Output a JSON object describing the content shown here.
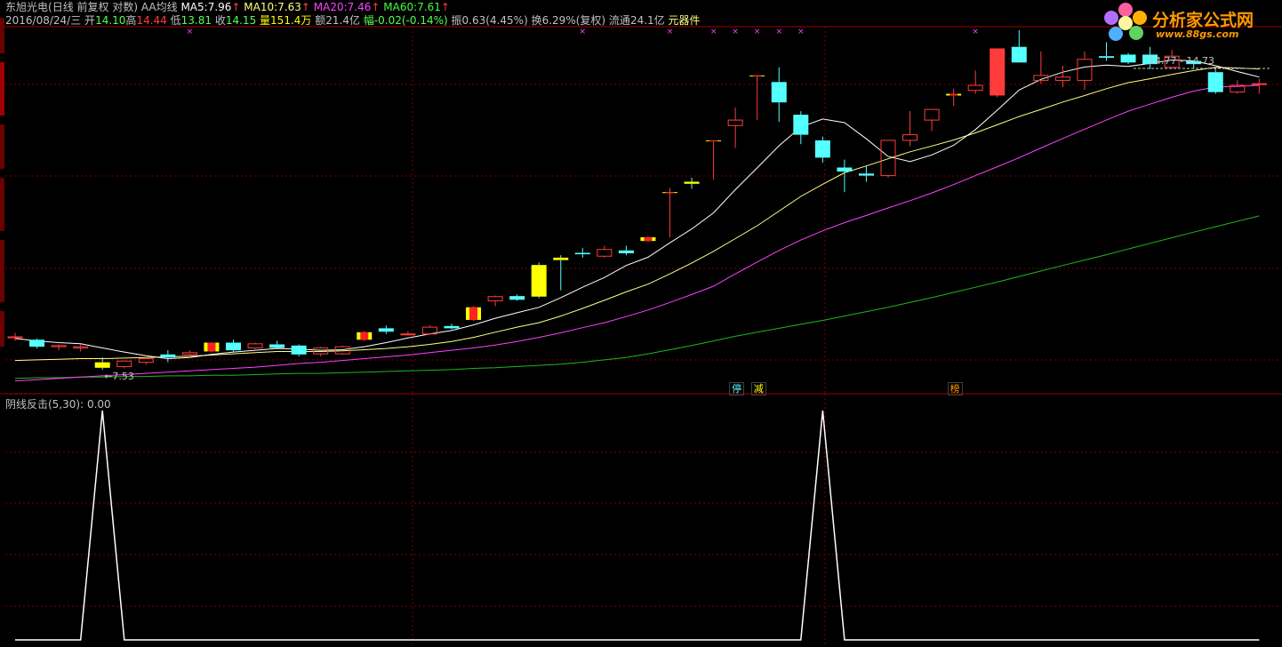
{
  "header": {
    "stock": "东旭光电",
    "mode": "(日线 前复权 对数)",
    "ma_title": "AA均线",
    "ma5_label": "MA5:",
    "ma5": "7.96",
    "ma10_label": "MA10:",
    "ma10": "7.63",
    "ma20_label": "MA20:",
    "ma20": "7.46",
    "ma60_label": "MA60:",
    "ma60": "7.61",
    "up_arrow": "↑",
    "date": "2016/08/24/三",
    "open_label": "开",
    "open": "14.10",
    "high_label": "高",
    "high": "14.44",
    "low_label": "低",
    "low": "13.81",
    "close_label": "收",
    "close": "14.15",
    "vol_label": "量",
    "vol": "151.4万",
    "amt_label": "额",
    "amt": "21.4亿",
    "chg_label": "幅",
    "chg": "-0.02(-0.14%)",
    "amp_label": "振",
    "amp": "0.63(4.45%)",
    "turn_label": "换",
    "turn": "6.29%(复权)",
    "float_label": "流通",
    "float": "24.1亿",
    "sector": "元器件"
  },
  "indicator": {
    "name": "阴线反击(5,30)",
    "value_text": ": 0.00"
  },
  "logo": {
    "text": "分析家公式网",
    "url": "www.88gs.com"
  },
  "colors": {
    "up": "#ff3c3c",
    "down": "#54ffff",
    "ma5": "#ffffff",
    "ma10": "#ffff80",
    "ma20": "#ff40ff",
    "ma60": "#1db81d",
    "signal": "#ffff00",
    "grid": "#800000"
  },
  "chart_data": {
    "type": "candlestick",
    "log_scale": true,
    "price_axis_range": [
      7.3,
      15.6
    ],
    "low_marker": "←7.53",
    "high_marker": "14.77 - 14.73",
    "tags": [
      {
        "text": "停",
        "index": 33
      },
      {
        "text": "减",
        "index": 34
      },
      {
        "text": "榜",
        "index": 43
      }
    ],
    "ohlc": [
      [
        8.05,
        8.12,
        7.98,
        8.05
      ],
      [
        8.0,
        8.02,
        7.85,
        7.88
      ],
      [
        7.88,
        7.92,
        7.82,
        7.9
      ],
      [
        7.86,
        7.92,
        7.8,
        7.88
      ],
      [
        7.62,
        7.7,
        7.5,
        7.53
      ],
      [
        7.55,
        7.65,
        7.52,
        7.64
      ],
      [
        7.62,
        7.7,
        7.58,
        7.68
      ],
      [
        7.75,
        7.82,
        7.62,
        7.7
      ],
      [
        7.75,
        7.82,
        7.7,
        7.78
      ],
      [
        7.8,
        7.96,
        7.78,
        7.95
      ],
      [
        7.95,
        8.0,
        7.8,
        7.82
      ],
      [
        7.86,
        7.95,
        7.84,
        7.93
      ],
      [
        7.92,
        7.98,
        7.85,
        7.86
      ],
      [
        7.9,
        7.92,
        7.72,
        7.75
      ],
      [
        7.76,
        7.88,
        7.72,
        7.86
      ],
      [
        7.76,
        7.9,
        7.74,
        7.88
      ],
      [
        8.0,
        8.15,
        7.98,
        8.13
      ],
      [
        8.2,
        8.25,
        8.1,
        8.14
      ],
      [
        8.1,
        8.15,
        8.07,
        8.1
      ],
      [
        8.1,
        8.25,
        8.08,
        8.22
      ],
      [
        8.24,
        8.28,
        8.18,
        8.2
      ],
      [
        8.35,
        8.6,
        8.33,
        8.58
      ],
      [
        8.7,
        8.8,
        8.6,
        8.78
      ],
      [
        8.79,
        8.82,
        8.7,
        8.72
      ],
      [
        9.4,
        9.45,
        8.75,
        8.78
      ],
      [
        9.55,
        9.6,
        8.9,
        9.5
      ],
      [
        9.65,
        9.75,
        9.55,
        9.62
      ],
      [
        9.58,
        9.8,
        9.55,
        9.72
      ],
      [
        9.7,
        9.8,
        9.6,
        9.64
      ],
      [
        9.9,
        10.0,
        9.88,
        9.98
      ],
      [
        11.0,
        11.1,
        9.98,
        11.0
      ],
      [
        11.25,
        11.35,
        11.08,
        11.2
      ],
      [
        12.3,
        12.3,
        11.3,
        12.3
      ],
      [
        12.7,
        13.2,
        12.1,
        12.85
      ],
      [
        14.15,
        14.15,
        12.85,
        14.15
      ],
      [
        13.95,
        14.4,
        12.8,
        13.35
      ],
      [
        13.0,
        13.1,
        12.2,
        12.45
      ],
      [
        12.3,
        12.4,
        11.72,
        11.85
      ],
      [
        11.6,
        11.8,
        11.0,
        11.5
      ],
      [
        11.45,
        11.65,
        11.25,
        11.4
      ],
      [
        11.4,
        12.3,
        11.35,
        12.3
      ],
      [
        12.3,
        13.1,
        12.15,
        12.45
      ],
      [
        12.85,
        13.15,
        12.55,
        13.15
      ],
      [
        13.55,
        13.75,
        13.25,
        13.6
      ],
      [
        13.7,
        14.3,
        13.6,
        13.85
      ],
      [
        13.55,
        15.0,
        13.5,
        15.0
      ],
      [
        15.05,
        15.6,
        14.9,
        14.55
      ],
      [
        14.0,
        14.9,
        13.9,
        14.15
      ],
      [
        14.0,
        14.45,
        13.8,
        14.1
      ],
      [
        14.0,
        14.9,
        13.72,
        14.65
      ],
      [
        14.75,
        15.2,
        14.6,
        14.7
      ],
      [
        14.8,
        14.85,
        14.5,
        14.55
      ],
      [
        14.8,
        15.05,
        14.35,
        14.5
      ],
      [
        14.4,
        14.95,
        14.35,
        14.75
      ],
      [
        14.6,
        14.6,
        14.35,
        14.5
      ],
      [
        14.25,
        14.35,
        13.6,
        13.65
      ],
      [
        13.65,
        14.0,
        13.6,
        13.85
      ],
      [
        13.88,
        14.05,
        13.6,
        13.9
      ]
    ],
    "signals": [
      0,
      0,
      0,
      0,
      1,
      0,
      0,
      0,
      0,
      1,
      0,
      0,
      0,
      0,
      0,
      0,
      1,
      0,
      0,
      0,
      0,
      1,
      0,
      0,
      1,
      1,
      0,
      0,
      0,
      1,
      1,
      1,
      1,
      0,
      1,
      0,
      0,
      0,
      0,
      0,
      0,
      0,
      0,
      1,
      0,
      0,
      0,
      0,
      0,
      0,
      0,
      0,
      0,
      0,
      0,
      0,
      0,
      0
    ],
    "ma5": [
      8.02,
      7.98,
      7.95,
      7.93,
      7.86,
      7.79,
      7.73,
      7.68,
      7.7,
      7.75,
      7.79,
      7.82,
      7.85,
      7.84,
      7.82,
      7.83,
      7.88,
      7.95,
      8.03,
      8.1,
      8.16,
      8.26,
      8.38,
      8.48,
      8.58,
      8.76,
      8.96,
      9.15,
      9.39,
      9.56,
      9.86,
      10.16,
      10.52,
      11.06,
      11.59,
      12.16,
      12.66,
      12.88,
      12.78,
      12.34,
      11.88,
      11.75,
      11.92,
      12.17,
      12.59,
      13.13,
      13.71,
      14.03,
      14.25,
      14.41,
      14.47,
      14.43,
      14.52,
      14.63,
      14.6,
      14.45,
      14.27,
      14.1
    ],
    "ma10": [
      7.65,
      7.66,
      7.67,
      7.68,
      7.68,
      7.69,
      7.7,
      7.71,
      7.72,
      7.74,
      7.76,
      7.78,
      7.8,
      7.8,
      7.8,
      7.81,
      7.83,
      7.85,
      7.88,
      7.92,
      7.97,
      8.04,
      8.13,
      8.22,
      8.3,
      8.42,
      8.56,
      8.71,
      8.87,
      9.02,
      9.22,
      9.44,
      9.68,
      9.95,
      10.23,
      10.56,
      10.9,
      11.19,
      11.47,
      11.64,
      11.82,
      12.0,
      12.15,
      12.31,
      12.5,
      12.72,
      12.95,
      13.15,
      13.36,
      13.55,
      13.75,
      13.93,
      14.05,
      14.18,
      14.3,
      14.4,
      14.38,
      14.35
    ],
    "ma20": [
      7.32,
      7.34,
      7.36,
      7.38,
      7.4,
      7.42,
      7.44,
      7.46,
      7.48,
      7.5,
      7.52,
      7.54,
      7.57,
      7.6,
      7.62,
      7.65,
      7.68,
      7.71,
      7.74,
      7.78,
      7.82,
      7.86,
      7.91,
      7.97,
      8.04,
      8.12,
      8.21,
      8.3,
      8.41,
      8.53,
      8.67,
      8.82,
      8.98,
      9.22,
      9.46,
      9.7,
      9.92,
      10.12,
      10.3,
      10.46,
      10.63,
      10.8,
      10.98,
      11.18,
      11.4,
      11.62,
      11.85,
      12.1,
      12.35,
      12.6,
      12.85,
      13.1,
      13.3,
      13.5,
      13.68,
      13.8,
      13.82,
      13.85
    ],
    "ma60": [
      7.36,
      7.37,
      7.37,
      7.38,
      7.38,
      7.39,
      7.39,
      7.4,
      7.4,
      7.41,
      7.41,
      7.42,
      7.43,
      7.44,
      7.44,
      7.45,
      7.46,
      7.47,
      7.48,
      7.49,
      7.5,
      7.52,
      7.53,
      7.55,
      7.57,
      7.59,
      7.62,
      7.66,
      7.7,
      7.76,
      7.83,
      7.9,
      7.98,
      8.06,
      8.13,
      8.2,
      8.27,
      8.34,
      8.42,
      8.5,
      8.58,
      8.67,
      8.76,
      8.86,
      8.96,
      9.06,
      9.17,
      9.28,
      9.39,
      9.5,
      9.61,
      9.73,
      9.85,
      9.97,
      10.09,
      10.21,
      10.33,
      10.45
    ],
    "indicator_values": [
      0,
      0,
      0,
      0,
      1,
      0,
      0,
      0,
      0,
      0,
      0,
      0,
      0,
      0,
      0,
      0,
      0,
      0,
      0,
      0,
      0,
      0,
      0,
      0,
      0,
      0,
      0,
      0,
      0,
      0,
      0,
      0,
      0,
      0,
      0,
      0,
      0,
      1,
      0,
      0,
      0,
      0,
      0,
      0,
      0,
      0,
      0,
      0,
      0,
      0,
      0,
      0,
      0,
      0,
      0,
      0,
      0,
      0
    ],
    "indicator_range": [
      0,
      1
    ]
  }
}
